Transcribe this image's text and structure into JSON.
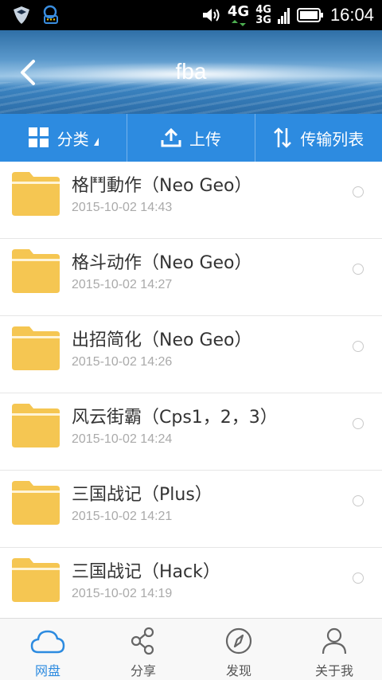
{
  "status_bar": {
    "net1": "4G",
    "net2_top": "4G",
    "net2_bottom": "3G",
    "time": "16:04"
  },
  "header": {
    "title": "fba"
  },
  "toolbar": {
    "category_label": "分类",
    "upload_label": "上传",
    "transfer_label": "传输列表"
  },
  "files": [
    {
      "name": "格鬥動作（Neo Geo）",
      "date": "2015-10-02  14:43"
    },
    {
      "name": "格斗动作（Neo Geo）",
      "date": "2015-10-02  14:27"
    },
    {
      "name": "出招简化（Neo Geo）",
      "date": "2015-10-02  14:26"
    },
    {
      "name": "风云街霸（Cps1，2，3）",
      "date": "2015-10-02  14:24"
    },
    {
      "name": "三国战记（Plus）",
      "date": "2015-10-02  14:21"
    },
    {
      "name": "三国战记（Hack）",
      "date": "2015-10-02  14:19"
    }
  ],
  "bottom_nav": {
    "items": [
      {
        "label": "网盘",
        "icon": "cloud-icon"
      },
      {
        "label": "分享",
        "icon": "share-icon"
      },
      {
        "label": "发现",
        "icon": "compass-icon"
      },
      {
        "label": "关于我",
        "icon": "user-icon"
      }
    ]
  },
  "colors": {
    "accent": "#2d8be0",
    "folder": "#f5c652"
  }
}
